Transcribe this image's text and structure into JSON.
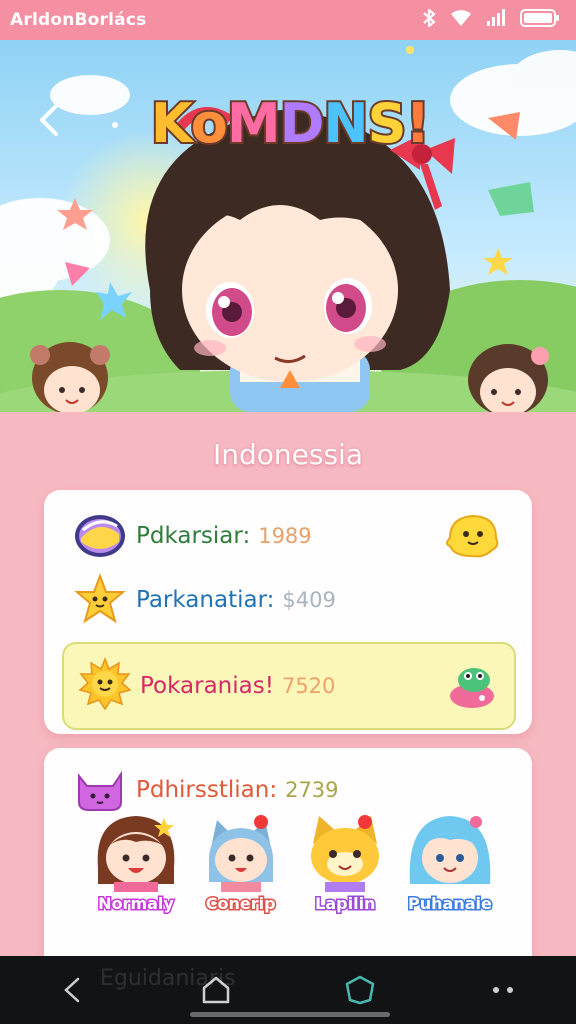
{
  "status_bar": {
    "app_name": "ArldonBorlács",
    "icons": [
      "bluetooth-icon",
      "wifi-icon",
      "signal-icon",
      "battery-icon"
    ]
  },
  "hero": {
    "title": "KoMDNS!",
    "back_icon": "back-arrow-icon"
  },
  "country_label": "Indonessia",
  "stats_card": {
    "rows": [
      {
        "icon": "capsule-icon",
        "label": "Pdkarsiar:",
        "value": "1989",
        "side_icon": "yellow-blob-icon"
      },
      {
        "icon": "star-face-icon",
        "label": "Parkanatiar:",
        "value": "$409"
      },
      {
        "icon": "sun-face-icon",
        "label": "Pokaranias!",
        "value": "7520",
        "side_icon": "frog-icon",
        "highlighted": true
      }
    ]
  },
  "characters_card": {
    "header": {
      "icon": "purple-cat-icon",
      "label": "Pdhirsstlian:",
      "value": "2739"
    },
    "characters": [
      {
        "name": "Normaly",
        "avatar": "brown-hair-girl-avatar"
      },
      {
        "name": "Conerip",
        "avatar": "blue-cat-ear-avatar"
      },
      {
        "name": "Lapilin",
        "avatar": "yellow-cat-avatar"
      },
      {
        "name": "Puhanaie",
        "avatar": "blue-hair-girl-avatar"
      }
    ]
  },
  "nav_bar": {
    "ghost_text": "Eguidaniaris",
    "buttons": [
      "back-nav-icon",
      "home-nav-icon",
      "recents-nav-icon",
      "more-nav-icon"
    ]
  },
  "colors": {
    "status_bar": "#f58fa2",
    "background": "#f7b9c1",
    "highlight_row": "#fbf7b8",
    "navbar": "#121314"
  }
}
